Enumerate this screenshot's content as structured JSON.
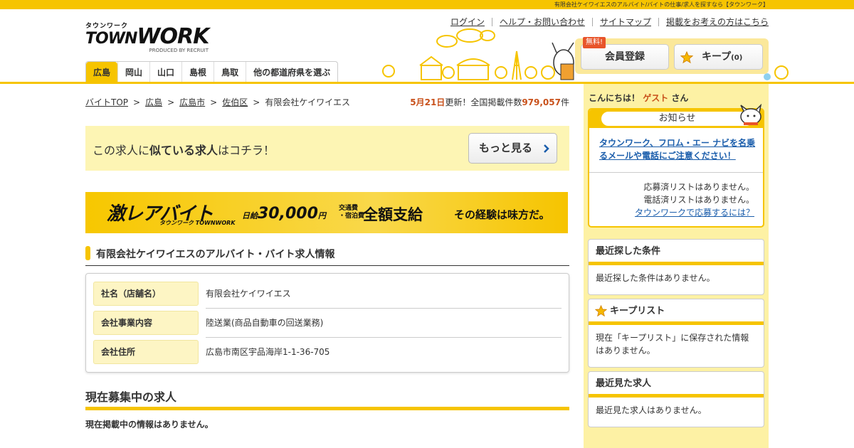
{
  "topbar": {
    "tagline": "有限会社ケイワイエスのアルバイト/バイトの仕事/求人を探すなら【タウンワーク】"
  },
  "logo": {
    "kana": "タウンワーク",
    "brand_a": "TOWN",
    "brand_b": "WORK",
    "byline": "PRODUCED BY RECRUIT"
  },
  "toplinks": [
    "ログイン",
    "ヘルプ・お問い合わせ",
    "サイトマップ",
    "掲載をお考えの方はこちら"
  ],
  "tabs": [
    "広島",
    "岡山",
    "山口",
    "島根",
    "鳥取",
    "他の都道府県を選ぶ"
  ],
  "member": {
    "free_badge": "無料!",
    "register": "会員登録",
    "keep": "キープ",
    "keep_count": "(0)"
  },
  "breadcrumb": [
    "バイトTOP",
    "広島",
    "広島市",
    "佐伯区",
    "有限会社ケイワイエス"
  ],
  "update": {
    "date": "5月21日",
    "text1": "更新！全国掲載件数",
    "count": "979,057",
    "unit": "件"
  },
  "similar": {
    "pre": "この求人に",
    "bold": "似ている求人",
    "post": "はコチラ！",
    "more": "もっと見る"
  },
  "banner": {
    "title": "激レアバイト",
    "sub": "タウンワーク TOWNWORK",
    "pay_label": "日給",
    "pay": "30,000",
    "pay_unit": "円",
    "cond1": "交通費",
    "cond2": "・宿泊費",
    "cond3": "全額支給",
    "tagline": "その経験は味方だ。"
  },
  "section": {
    "title": "有限会社ケイワイエスのアルバイト・バイト求人情報"
  },
  "company": [
    {
      "label": "社名（店舗名）",
      "value": "有限会社ケイワイエス"
    },
    {
      "label": "会社事業内容",
      "value": "陸送業(商品自動車の回送業務)"
    },
    {
      "label": "会社住所",
      "value": "広島市南区宇品海岸1-1-36-705"
    }
  ],
  "jobs": {
    "title": "現在募集中の求人",
    "empty": "現在掲載中の情報はありません。"
  },
  "sidebar": {
    "hello_pre": "こんにちは！",
    "guest": "ゲスト",
    "hello_post": "さん",
    "notice_title": "お知らせ",
    "notice_link": "タウンワーク、フロム・エー ナビを名乗るメールや電話にご注意ください！",
    "applied": "応募済リストはありません。",
    "called": "電話済リストはありません。",
    "howto": "タウンワークで応募するには？",
    "recent_search_title": "最近探した条件",
    "recent_search_body": "最近探した条件はありません。",
    "keep_title": "キープリスト",
    "keep_body": "現在「キープリスト」に保存された情報はありません。",
    "recent_view_title": "最近見た求人",
    "recent_view_body": "最近見た求人はありません。"
  },
  "colors": {
    "brand_yellow": "#f6c400",
    "accent_orange": "#c8501a",
    "link_blue": "#1a5dab"
  }
}
